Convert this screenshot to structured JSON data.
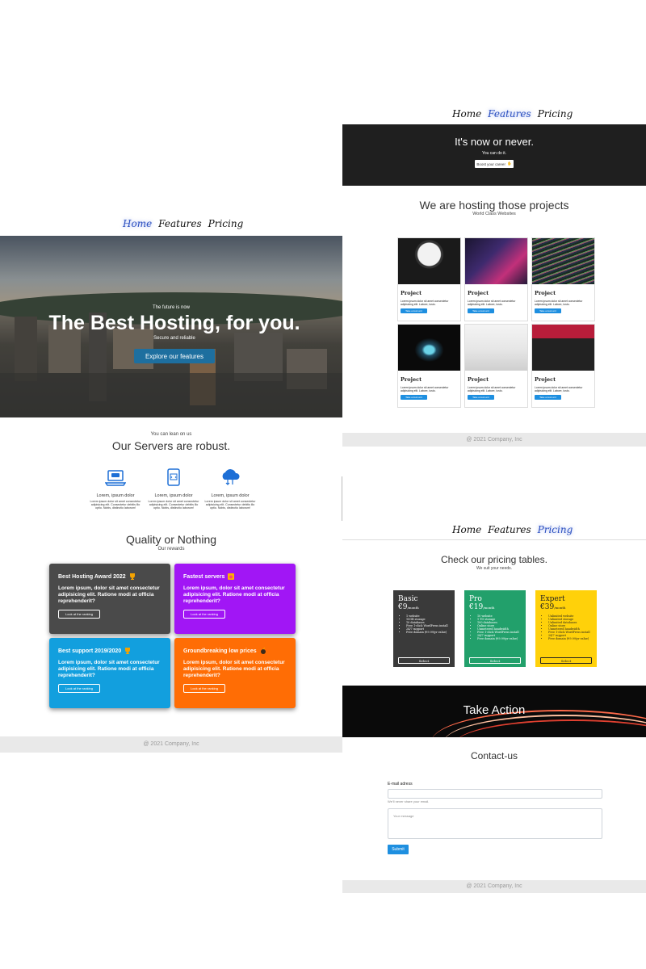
{
  "nav": {
    "home": "Home",
    "features": "Features",
    "pricing": "Pricing"
  },
  "hero": {
    "tag": "The future is now",
    "title": "The Best Hosting, for you.",
    "subtitle": "Secure and reliable",
    "cta": "Explore our features"
  },
  "servers": {
    "tag": "You can lean on us",
    "title": "Our Servers are robust.",
    "features": [
      {
        "icon": "laptop-chat-icon",
        "title": "Lorem, ipsum dolor",
        "desc": "Lorem ipsum dolor sit amet consectetur adipisicing elit. Consectetur debitis illo optio. Nobis, distinctio laborum!"
      },
      {
        "icon": "phone-code-icon",
        "title": "Lorem, ipsum dolor",
        "desc": "Lorem ipsum dolor sit amet consectetur adipisicing elit. Consectetur debitis illo optio. Nobis, distinctio laborum!"
      },
      {
        "icon": "cloud-transfer-icon",
        "title": "Lorem, ipsum dolor",
        "desc": "Lorem ipsum dolor sit amet consectetur adipisicing elit. Consectetur debitis illo optio. Nobis, distinctio laborum!"
      }
    ]
  },
  "rewards": {
    "title": "Quality or Nothing",
    "subtitle": "Our rewards",
    "cards": [
      {
        "title": "Best Hosting Award 2022",
        "text": "Lorem ipsum, dolor sit amet consectetur adipisicing elit. Ratione modi at officia reprehenderit?",
        "button": "Look at the ranking",
        "color": "#4a4a4a"
      },
      {
        "title": "Fastest servers",
        "text": "Lorem ipsum, dolor sit amet consectetur adipisicing elit. Ratione modi at officia reprehenderit?",
        "button": "Look at the ranking",
        "color": "#a116f5"
      },
      {
        "title": "Best support 2019/2020",
        "text": "Lorem ipsum, dolor sit amet consectetur adipisicing elit. Ratione modi at officia reprehenderit?",
        "button": "Look at the ranking",
        "color": "#129fde"
      },
      {
        "title": "Groundbreaking low prices",
        "text": "Lorem ipsum, dolor sit amet consectetur adipisicing elit. Ratione modi at officia reprehenderit?",
        "button": "Look at the ranking",
        "color": "#ff6d05"
      }
    ]
  },
  "footer": "@ 2021 Company, Inc",
  "banner": {
    "title": "It's now or never.",
    "subtitle": "You can do it.",
    "button": "Boost your career"
  },
  "projects": {
    "title": "We are hosting those projects",
    "subtitle": "World Class Websites",
    "items": [
      {
        "title": "Project",
        "desc": "Lorem ipsum dolor sit amet consectetur adipisicing elit. Labore, iusto.",
        "button": "Take a look at it"
      },
      {
        "title": "Project",
        "desc": "Lorem ipsum dolor sit amet consectetur adipisicing elit. Labore, iusto.",
        "button": "Take a look at it"
      },
      {
        "title": "Project",
        "desc": "Lorem ipsum dolor sit amet consectetur adipisicing elit. Labore, iusto.",
        "button": "Take a look at it"
      },
      {
        "title": "Project",
        "desc": "Lorem ipsum dolor sit amet consectetur adipisicing elit. Labore, iusto.",
        "button": "Take a look at it"
      },
      {
        "title": "Project",
        "desc": "Lorem ipsum dolor sit amet consectetur adipisicing elit. Labore, iusto.",
        "button": "Take a look at it"
      },
      {
        "title": "Project",
        "desc": "Lorem ipsum dolor sit amet consectetur adipisicing elit. Labore, iusto.",
        "button": "Take a look at it"
      }
    ]
  },
  "pricing": {
    "title": "Check our pricing tables.",
    "subtitle": "We suit your needs.",
    "plans": [
      {
        "name": "Basic",
        "price": "€9",
        "unit": "/month",
        "color": "#3a3a3a",
        "features": [
          "1 website",
          "10GB storage",
          "10 databases",
          "Free 1-click WordPress install",
          "24/7 support",
          "Free domain (€9.99/yr value)"
        ],
        "button": "Select"
      },
      {
        "name": "Pro",
        "price": "€19",
        "unit": "/month",
        "color": "#22a06b",
        "features": [
          "10 website",
          "1 TO storage",
          "100 databases",
          "Online store",
          "Unmetered bandwidth",
          "Free 1-click WordPress install",
          "24/7 support",
          "Free domain (€9.99/yr value)"
        ],
        "button": "Select"
      },
      {
        "name": "Expert",
        "price": "€39",
        "unit": "/month",
        "color": "#ffd10a",
        "features": [
          "Unlimited website",
          "Unlimited storage",
          "Unlimited databases",
          "Online store",
          "Unmetered bandwidth",
          "Free 1-click WordPress install",
          "24/7 support",
          "Free domain (€9.99/yr value)"
        ],
        "button": "Select"
      }
    ]
  },
  "take_action": "Take Action",
  "contact": {
    "title": "Contact-us",
    "email_label": "E-mail adress",
    "email_help": "We'll never share your email.",
    "message_placeholder": "Your message",
    "submit": "Submit"
  }
}
